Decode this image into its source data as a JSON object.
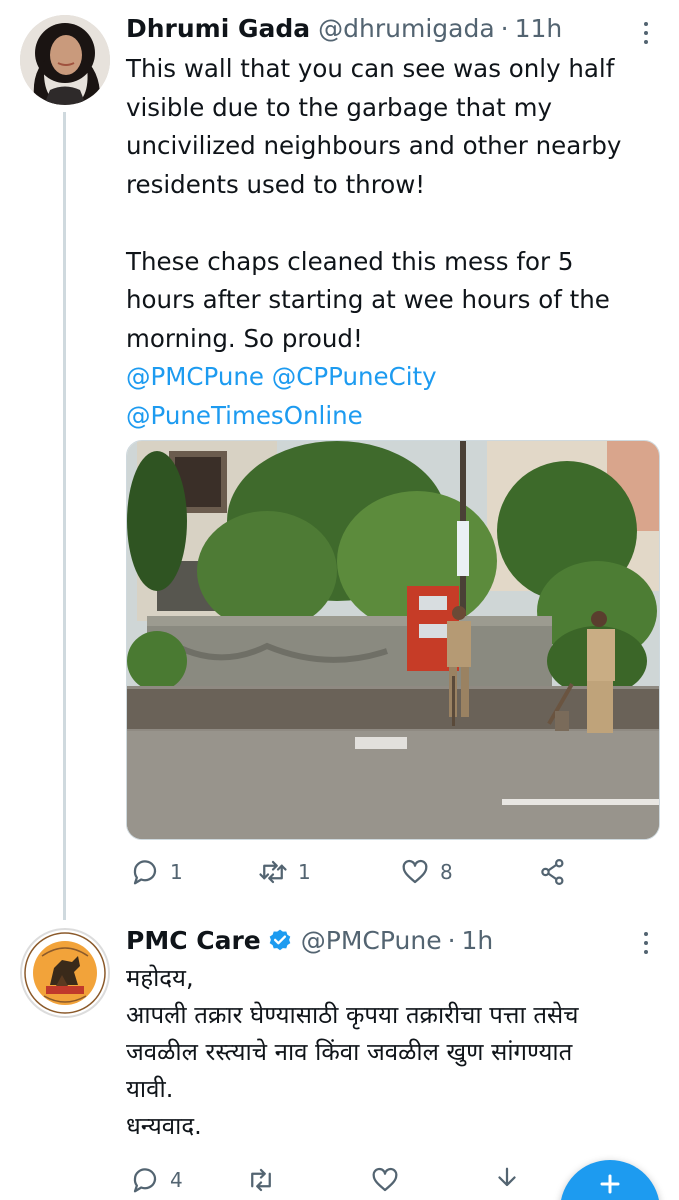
{
  "tweet1": {
    "author_name": "Dhrumi Gada",
    "handle": "@dhrumigada",
    "separator": "·",
    "time": "11h",
    "text_lines": [
      "This wall that you can see was only half",
      "visible due to the garbage that my",
      "uncivilized neighbours and other nearby",
      "residents used to throw!"
    ],
    "text_lines_2": [
      "These chaps cleaned this mess for 5",
      "hours after starting at wee hours of the",
      "morning. So proud!"
    ],
    "mentions_line1": "@PMCPune @CPPuneCity",
    "mentions_line2": "@PuneTimesOnline",
    "reply_count": "1",
    "retweet_count": "1",
    "like_count": "8"
  },
  "tweet2": {
    "author_name": "PMC Care",
    "handle": "@PMCPune",
    "separator": "·",
    "time": "1h",
    "text_lines": [
      "महोदय,",
      "आपली तक्रार घेण्यासाठी कृपया तक्रारीचा पत्ता तसेच",
      "जवळील रस्त्याचे नाव किंवा जवळील खुण सांगण्यात",
      "यावी.",
      "धन्यवाद."
    ],
    "reply_count": "4"
  },
  "colors": {
    "accent": "#1d9bf0",
    "text_primary": "#0f1419",
    "text_secondary": "#536471",
    "thread_line": "#cfd9de"
  },
  "icons": [
    "more-vertical-icon",
    "reply-icon",
    "retweet-icon",
    "like-icon",
    "share-icon",
    "verified-badge-icon",
    "compose-icon",
    "download-icon"
  ]
}
